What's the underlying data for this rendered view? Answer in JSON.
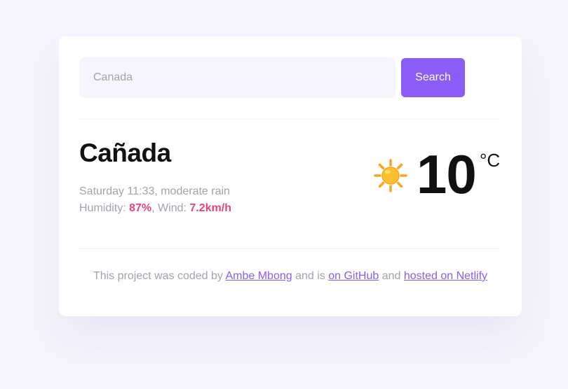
{
  "search": {
    "placeholder": "Canada",
    "button_label": "Search"
  },
  "current": {
    "city": "Cañada",
    "datetime_condition": "Saturday 11:33, moderate rain",
    "humidity_label": "Humidity: ",
    "humidity_value": "87%",
    "wind_label": ", Wind: ",
    "wind_value": "7.2km/h",
    "icon": "sun-icon",
    "temperature": "10",
    "unit": "°C"
  },
  "footer": {
    "text_1": "This project was coded by ",
    "author_link": "Ambe Mbong",
    "text_2": " and is ",
    "github_link": "on GitHub",
    "text_3": " and ",
    "netlify_link": "hosted on Netlify"
  },
  "colors": {
    "accent": "#8b5cf6",
    "highlight": "#e5457a",
    "background": "#f6f5fd"
  }
}
